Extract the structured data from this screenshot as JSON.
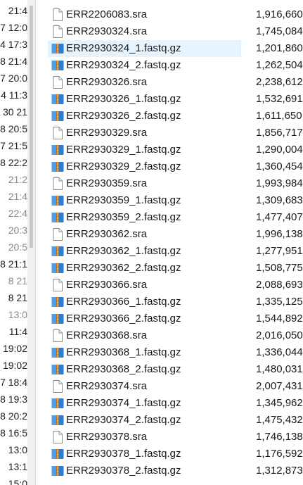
{
  "left_pane": {
    "rows": [
      {
        "text": "21:4",
        "dim": false
      },
      {
        "text": "7 12:0",
        "dim": false
      },
      {
        "text": "4 17:3",
        "dim": false
      },
      {
        "text": "8 21:4",
        "dim": false
      },
      {
        "text": "7 20:0",
        "dim": false
      },
      {
        "text": "4 11:3",
        "dim": false
      },
      {
        "text": "30 21",
        "dim": false
      },
      {
        "text": "8 20:5",
        "dim": false
      },
      {
        "text": "7 21:5",
        "dim": false
      },
      {
        "text": "8 22:2",
        "dim": false
      },
      {
        "text": "21:2",
        "dim": true
      },
      {
        "text": "21:4",
        "dim": true
      },
      {
        "text": "22:4",
        "dim": true
      },
      {
        "text": "20:3",
        "dim": true
      },
      {
        "text": "20:5",
        "dim": true
      },
      {
        "text": "8 21:1",
        "dim": false
      },
      {
        "text": "8 21",
        "dim": true
      },
      {
        "text": "8 21",
        "dim": false
      },
      {
        "text": "13:0",
        "dim": true
      },
      {
        "text": "11:4",
        "dim": false
      },
      {
        "text": "19:02",
        "dim": false
      },
      {
        "text": "19:02",
        "dim": false
      },
      {
        "text": "7 18:4",
        "dim": false
      },
      {
        "text": "8 19:3",
        "dim": false
      },
      {
        "text": "8 20:2",
        "dim": false
      },
      {
        "text": "8 16:5",
        "dim": false
      },
      {
        "text": "13:0",
        "dim": false
      },
      {
        "text": "13:1",
        "dim": false
      },
      {
        "text": "15:0",
        "dim": false
      }
    ]
  },
  "files": [
    {
      "name": "ERR2206083.sra",
      "size": "1,916,660",
      "type": "sra",
      "selected": false
    },
    {
      "name": "ERR2930324.sra",
      "size": "1,745,084",
      "type": "sra",
      "selected": false
    },
    {
      "name": "ERR2930324_1.fastq.gz",
      "size": "1,201,860",
      "type": "gz",
      "selected": true
    },
    {
      "name": "ERR2930324_2.fastq.gz",
      "size": "1,262,504",
      "type": "gz",
      "selected": false
    },
    {
      "name": "ERR2930326.sra",
      "size": "2,238,612",
      "type": "sra",
      "selected": false
    },
    {
      "name": "ERR2930326_1.fastq.gz",
      "size": "1,532,691",
      "type": "gz",
      "selected": false
    },
    {
      "name": "ERR2930326_2.fastq.gz",
      "size": "1,611,650",
      "type": "gz",
      "selected": false
    },
    {
      "name": "ERR2930329.sra",
      "size": "1,856,717",
      "type": "sra",
      "selected": false
    },
    {
      "name": "ERR2930329_1.fastq.gz",
      "size": "1,290,004",
      "type": "gz",
      "selected": false
    },
    {
      "name": "ERR2930329_2.fastq.gz",
      "size": "1,360,454",
      "type": "gz",
      "selected": false
    },
    {
      "name": "ERR2930359.sra",
      "size": "1,993,984",
      "type": "sra",
      "selected": false
    },
    {
      "name": "ERR2930359_1.fastq.gz",
      "size": "1,309,683",
      "type": "gz",
      "selected": false
    },
    {
      "name": "ERR2930359_2.fastq.gz",
      "size": "1,477,407",
      "type": "gz",
      "selected": false
    },
    {
      "name": "ERR2930362.sra",
      "size": "1,996,138",
      "type": "sra",
      "selected": false
    },
    {
      "name": "ERR2930362_1.fastq.gz",
      "size": "1,277,951",
      "type": "gz",
      "selected": false
    },
    {
      "name": "ERR2930362_2.fastq.gz",
      "size": "1,508,775",
      "type": "gz",
      "selected": false
    },
    {
      "name": "ERR2930366.sra",
      "size": "2,088,693",
      "type": "sra",
      "selected": false
    },
    {
      "name": "ERR2930366_1.fastq.gz",
      "size": "1,335,125",
      "type": "gz",
      "selected": false
    },
    {
      "name": "ERR2930366_2.fastq.gz",
      "size": "1,544,892",
      "type": "gz",
      "selected": false
    },
    {
      "name": "ERR2930368.sra",
      "size": "2,016,050",
      "type": "sra",
      "selected": false
    },
    {
      "name": "ERR2930368_1.fastq.gz",
      "size": "1,336,044",
      "type": "gz",
      "selected": false
    },
    {
      "name": "ERR2930368_2.fastq.gz",
      "size": "1,480,031",
      "type": "gz",
      "selected": false
    },
    {
      "name": "ERR2930374.sra",
      "size": "2,007,431",
      "type": "sra",
      "selected": false
    },
    {
      "name": "ERR2930374_1.fastq.gz",
      "size": "1,345,962",
      "type": "gz",
      "selected": false
    },
    {
      "name": "ERR2930374_2.fastq.gz",
      "size": "1,475,432",
      "type": "gz",
      "selected": false
    },
    {
      "name": "ERR2930378.sra",
      "size": "1,746,138",
      "type": "sra",
      "selected": false
    },
    {
      "name": "ERR2930378_1.fastq.gz",
      "size": "1,176,592",
      "type": "gz",
      "selected": false
    },
    {
      "name": "ERR2930378_2.fastq.gz",
      "size": "1,312,873",
      "type": "gz",
      "selected": false
    }
  ],
  "icons": {
    "sra": "blank-file-icon",
    "gz": "archive-file-icon"
  },
  "colors": {
    "selection": "#e5f3ff",
    "archive_blue": "#2e7bd6",
    "archive_orange": "#e8a33c"
  }
}
